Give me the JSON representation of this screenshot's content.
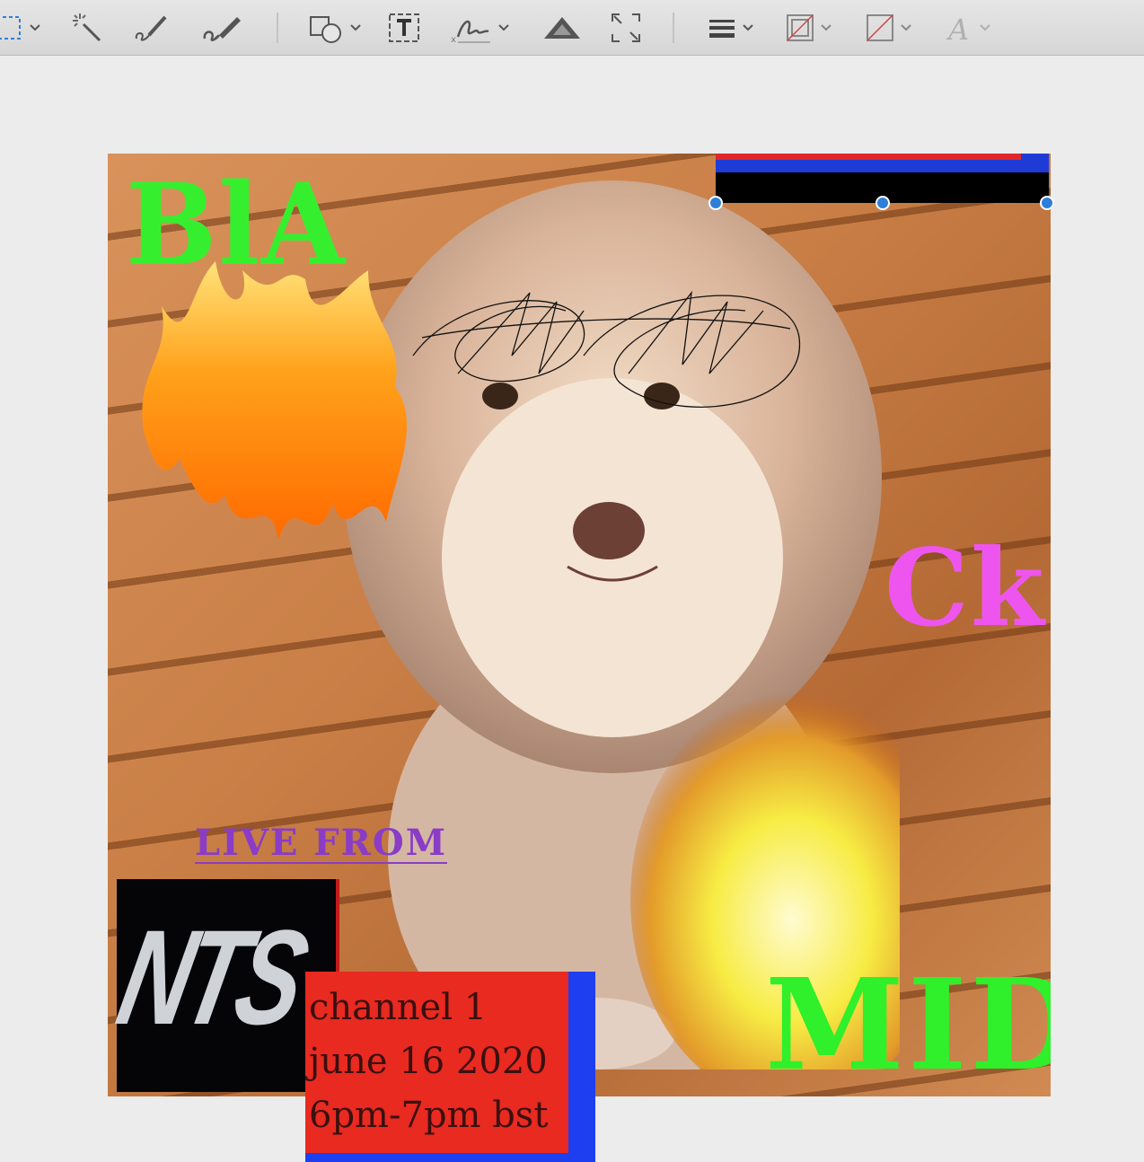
{
  "toolbar": {
    "tools": [
      {
        "name": "selection-rectangle-icon",
        "has_dropdown": true
      },
      {
        "name": "instant-alpha-icon"
      },
      {
        "name": "sketch-icon"
      },
      {
        "name": "draw-icon"
      },
      {
        "name": "shapes-icon",
        "has_dropdown": true
      },
      {
        "name": "text-box-icon"
      },
      {
        "name": "signature-icon",
        "has_dropdown": true
      },
      {
        "name": "adjust-color-icon"
      },
      {
        "name": "adjust-size-icon"
      },
      {
        "name": "shape-style-icon",
        "has_dropdown": true
      },
      {
        "name": "border-color-icon",
        "has_dropdown": true
      },
      {
        "name": "fill-color-icon",
        "has_dropdown": true
      },
      {
        "name": "text-style-icon",
        "has_dropdown": true
      }
    ],
    "colors": {
      "accent": "#2d7fd8",
      "icon": "#555555",
      "disabled": "#b0b0b0"
    }
  },
  "poster": {
    "word_top": "BlA",
    "word_right": "Ck",
    "word_bottom": "MIDI",
    "live_from": "LIVE FROM",
    "nts_logo": "NTS",
    "info_lines": [
      "channel 1",
      "june 16 2020",
      "6pm-7pm bst"
    ],
    "colors": {
      "green": "#35ef2e",
      "pink": "#ee55ee",
      "purple": "#8a3cc6",
      "red": "#e82a20",
      "blue": "#1e3ff0"
    }
  }
}
